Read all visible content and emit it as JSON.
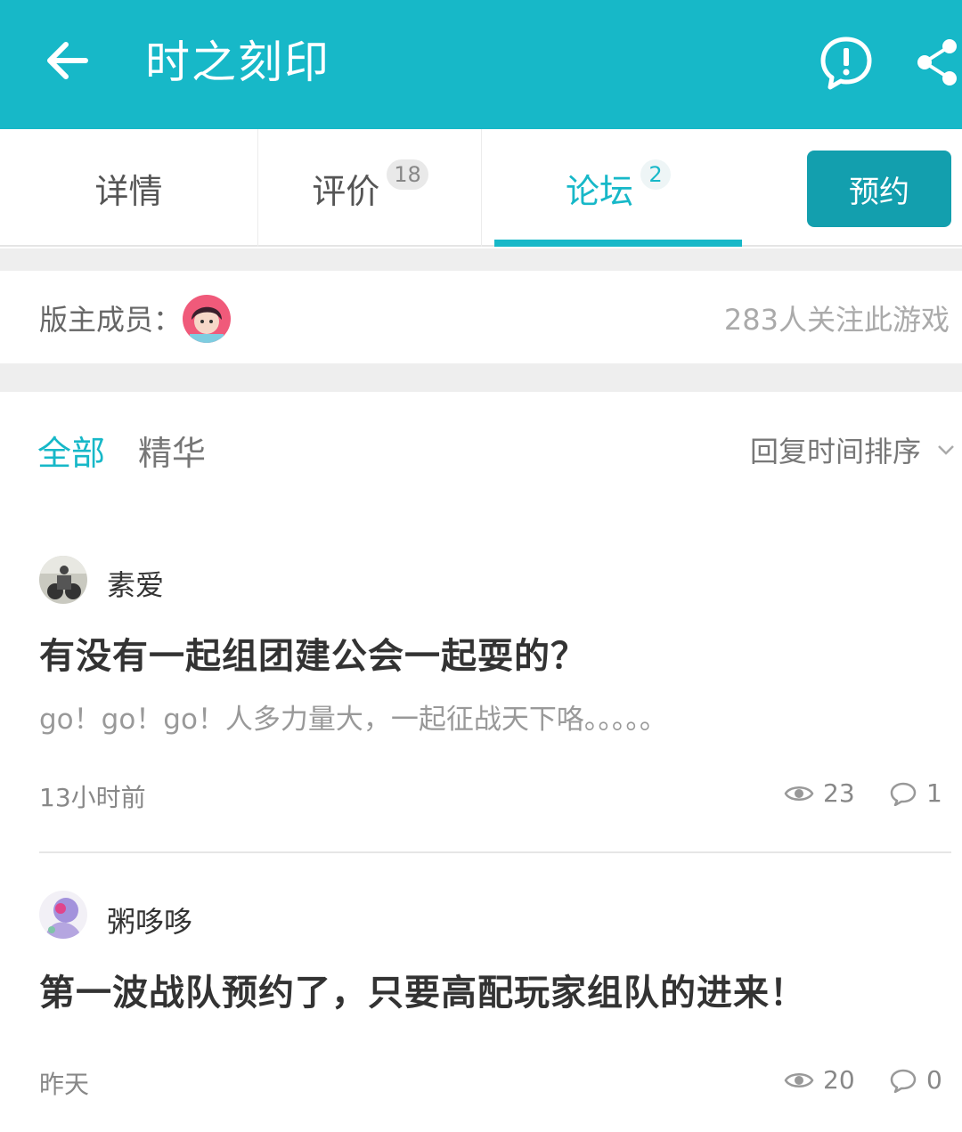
{
  "appbar": {
    "title": "时之刻印"
  },
  "tabs": [
    {
      "label": "详情",
      "badge": ""
    },
    {
      "label": "评价",
      "badge": "18"
    },
    {
      "label": "论坛",
      "badge": "2"
    }
  ],
  "reserve_label": "预约",
  "moderators": {
    "label": "版主成员：",
    "followers": "283人关注此游戏"
  },
  "filters": {
    "all": "全部",
    "best": "精华",
    "sort": "回复时间排序"
  },
  "posts": [
    {
      "author": "素爱",
      "title": "有没有一起组团建公会一起耍的？",
      "excerpt": "go！go！go！人多力量大，一起征战天下咯。。。。。",
      "time": "13小时前",
      "views": "23",
      "comments": "1"
    },
    {
      "author": "粥哆哆",
      "title": "第一波战队预约了，只要高配玩家组队的进来！",
      "excerpt": "",
      "time": "昨天",
      "views": "20",
      "comments": "0"
    }
  ],
  "colors": {
    "accent": "#17b8c8",
    "reserve_button": "#139fae"
  }
}
